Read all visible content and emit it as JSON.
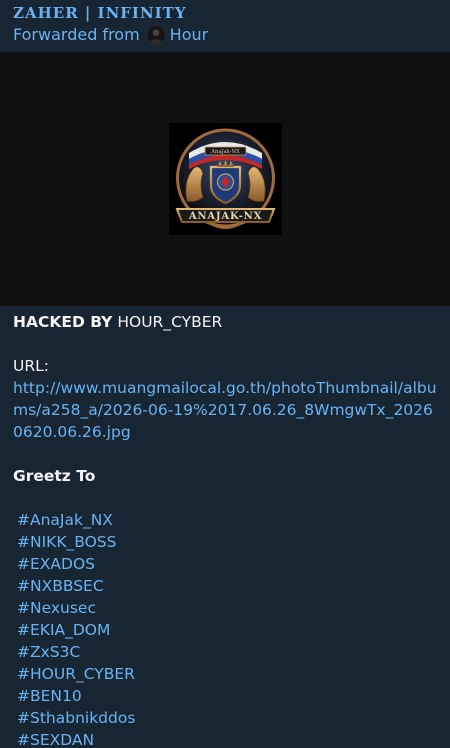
{
  "header": {
    "channel_name": "ZAHER | INFINITY",
    "forwarded_prefix": "Forwarded from",
    "forwarded_source": "Hour"
  },
  "media": {
    "logo_text": "ANAJAK-NX",
    "logo_small_text": "AnaJak-NX"
  },
  "message": {
    "hacked_by_label": "HACKED BY",
    "hacked_by_value": "HOUR_CYBER",
    "url_label": "URL:",
    "url": "http://www.muangmailocal.go.th/photoThumbnail/albums/a258_a/2026-06-19%2017.06.26_8WmgwTx_20260620.06.26.jpg",
    "greetz_label": "Greetz To",
    "hashtags": [
      "#AnaJak_NX",
      "#NIKK_BOSS",
      "#EXADOS",
      "#NXBBSEC",
      "#Nexusec",
      "#EKIA_DOM",
      "#ZxS3C",
      "#HOUR_CYBER",
      "#BEN10",
      "#Sthabnikddos",
      "#SEXDAN"
    ]
  },
  "colors": {
    "background": "#182533",
    "accent": "#6ab3f3",
    "text": "#f5f5f5",
    "media_bg": "#101010"
  }
}
